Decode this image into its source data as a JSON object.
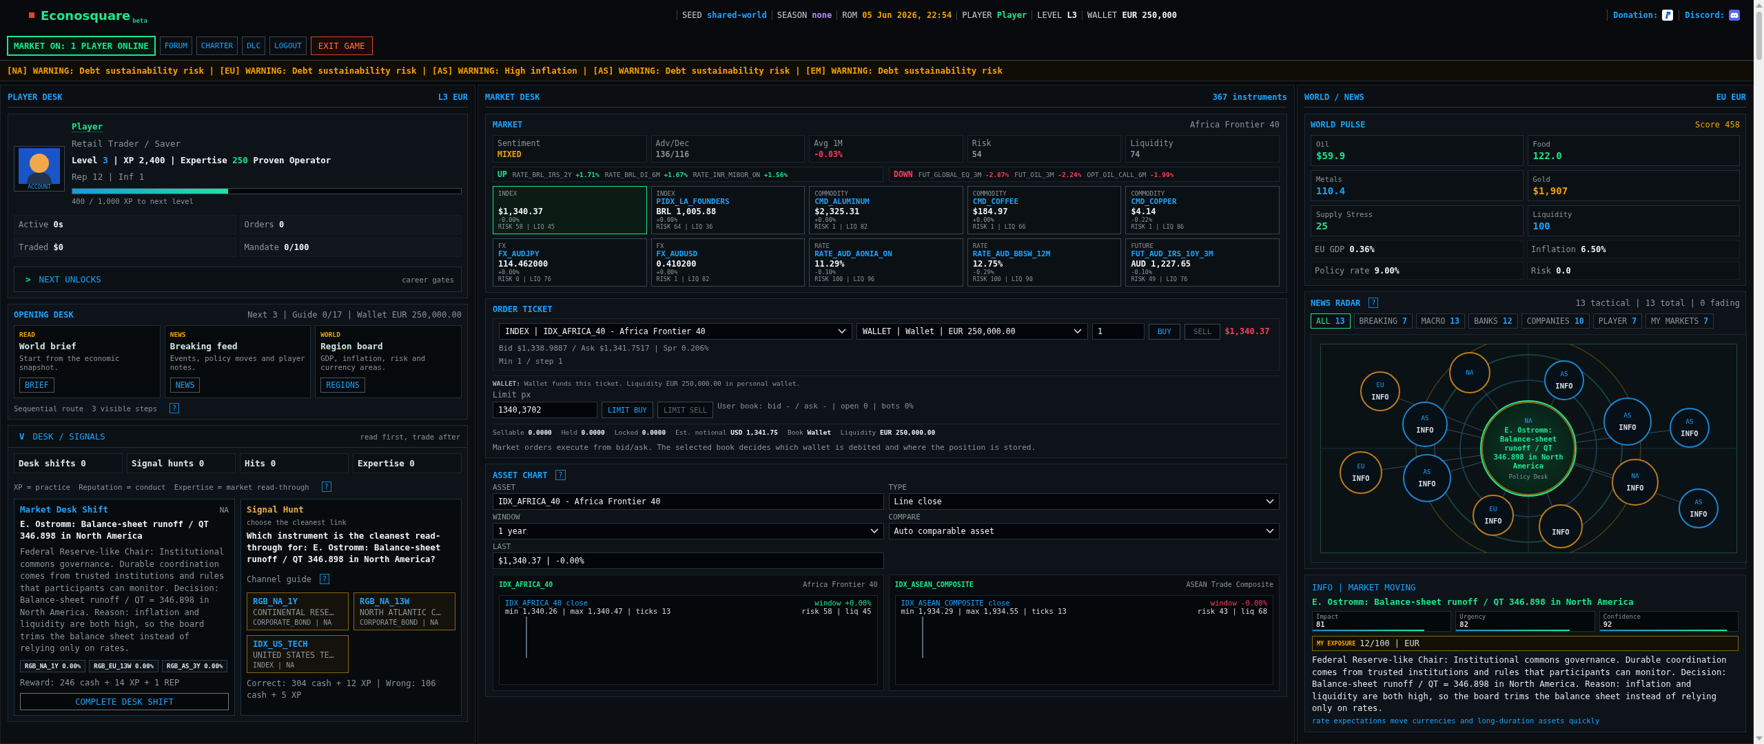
{
  "header": {
    "logo": "Econosquare",
    "logo_badge": "beta",
    "status": [
      {
        "label": "SEED",
        "value": "shared-world",
        "color": "#1aa3ff"
      },
      {
        "label": "SEASON",
        "value": "none",
        "color": "#b58cff"
      },
      {
        "label": "ROM",
        "value": "05 Jun 2026, 22:54",
        "color": "#f5a000"
      },
      {
        "label": "PLAYER",
        "value": "Player",
        "color": "#19e68c"
      },
      {
        "label": "LEVEL",
        "value": "L3",
        "color": "#eef2f5"
      },
      {
        "label": "WALLET",
        "value": "EUR 250,000",
        "color": "#eef2f5"
      }
    ],
    "links": [
      {
        "label": "Donation:"
      },
      {
        "label": "Discord:"
      }
    ],
    "market_status": "MARKET ON: 1 PLAYER ONLINE",
    "nav": [
      {
        "label": "FORUM",
        "kind": "nav"
      },
      {
        "label": "CHARTER",
        "kind": "nav"
      },
      {
        "label": "DLC",
        "kind": "nav"
      },
      {
        "label": "LOGOUT",
        "kind": "nav"
      },
      {
        "label": "EXIT GAME",
        "kind": "danger"
      }
    ]
  },
  "ticker": "[NA] WARNING: Debt sustainability risk | [EU] WARNING: Debt sustainability risk | [AS] WARNING: High inflation | [AS] WARNING: Debt sustainability risk | [EM] WARNING: Debt sustainability risk",
  "player_desk": {
    "title": "PLAYER DESK",
    "meta": "L3 EUR",
    "profile": {
      "name": "Player",
      "avatar_label": "ACCOUNT",
      "role": "Retail Trader / Saver",
      "stats_line": [
        {
          "text": "Level ",
          "color": "#eef2f5"
        },
        {
          "text": "3",
          "color": "#1aa3ff"
        },
        {
          "text": " | XP 2,400 | Expertise ",
          "color": "#eef2f5"
        },
        {
          "text": "250",
          "color": "#19e68c"
        },
        {
          "text": " Proven Operator",
          "color": "#eef2f5"
        }
      ],
      "rep": "Rep 12 | Inf 1",
      "level": 0.4,
      "xp_caption": "400 / 1,000 XP to next level"
    },
    "stats": [
      {
        "label": "Active",
        "value": "0s"
      },
      {
        "label": "Orders",
        "value": "0"
      },
      {
        "label": "Traded",
        "value": "$0"
      },
      {
        "label": "Mandate",
        "value": "0/100"
      }
    ],
    "unlocks": {
      "caret": ">",
      "label": "NEXT UNLOCKS",
      "meta": "career gates"
    }
  },
  "opening_desk": {
    "title": "OPENING DESK",
    "meta": "Next 3 | Guide 0/17 | Wallet EUR 250,000.00",
    "cards": [
      {
        "tag": "READ",
        "title": "World brief",
        "desc": "Start from the economic snapshot.",
        "button": "BRIEF"
      },
      {
        "tag": "NEWS",
        "title": "Breaking feed",
        "desc": "Events, policy moves and player notes.",
        "button": "NEWS"
      },
      {
        "tag": "WORLD",
        "title": "Region board",
        "desc": "GDP, inflation, risk and currency areas.",
        "button": "REGIONS"
      }
    ],
    "route": "Sequential route",
    "steps": "3 visible steps",
    "help": "?"
  },
  "signals": {
    "caret": "V",
    "title": "DESK / SIGNALS",
    "meta": "read first, trade after",
    "counters": [
      {
        "label": "Desk shifts",
        "value": "0"
      },
      {
        "label": "Signal hunts",
        "value": "0"
      },
      {
        "label": "Hits",
        "value": "0"
      },
      {
        "label": "Expertise",
        "value": "0"
      }
    ],
    "legend": [
      "XP = practice",
      "Reputation = conduct",
      "Expertise = market read-through"
    ],
    "help": "?",
    "shift": {
      "title": "Market Desk Shift",
      "region": "NA",
      "headline": "E. Ostromm: Balance-sheet runoff / QT 346.898 in North America",
      "body": "Federal Reserve-like Chair: Institutional commons governance. Durable coordination comes from trusted institutions and rules that participants can monitor. Decision: Balance-sheet runoff / QT = 346.898 in North America. Reason: inflation and liquidity are both high, so the board trims the balance sheet instead of relying only on rates.",
      "chips": [
        "RGB_NA_1Y 0.00%",
        "RGB_EU_13W 0.00%",
        "RGB_AS_3Y 0.00%"
      ],
      "reward": "Reward: 246 cash + 14 XP + 1 REP",
      "button": "COMPLETE DESK SHIFT"
    },
    "hunt": {
      "title": "Signal Hunt",
      "subtitle": "choose the cleanest link",
      "question": "Which instrument is the cleanest read-through for: E. Ostromm: Balance-sheet runoff / QT 346.898 in North America?",
      "guide": "Channel guide",
      "help": "?",
      "options": [
        {
          "symbol": "RGB_NA_1Y",
          "name": "CONTINENTAL RESE…",
          "meta": "CORPORATE_BOND | NA"
        },
        {
          "symbol": "RGB_NA_13W",
          "name": "NORTH ATLANTIC C…",
          "meta": "CORPORATE_BOND | NA"
        },
        {
          "symbol": "IDX_US_TECH",
          "name": "UNITED STATES TE…",
          "meta": "INDEX | NA"
        }
      ],
      "payout": "Correct: 304 cash + 12 XP | Wrong: 106 cash + 5 XP"
    }
  },
  "market_desk": {
    "title": "MARKET DESK",
    "meta": "367 instruments",
    "market": {
      "title": "MARKET",
      "meta": "Africa Frontier 40",
      "stats": [
        {
          "label": "Sentiment",
          "value": "MIXED",
          "color": "#f5a000"
        },
        {
          "label": "Adv/Dec",
          "value": "136/116",
          "color": "#8a949c"
        },
        {
          "label": "Avg 1M",
          "value": "-0.03%",
          "color": "#ff3b5c"
        },
        {
          "label": "Risk",
          "value": "54",
          "color": "#8a949c"
        },
        {
          "label": "Liquidity",
          "value": "74",
          "color": "#8a949c"
        }
      ],
      "movers": [
        {
          "label": "UP",
          "color": "#19e68c",
          "items": [
            {
              "symbol": "RATE_BRL_IRS_2Y",
              "change": "+1.71%"
            },
            {
              "symbol": "RATE_BRL_DI_6M",
              "change": "+1.67%"
            },
            {
              "symbol": "RATE_INR_MIBOR_ON",
              "change": "+1.56%"
            }
          ]
        },
        {
          "label": "DOWN",
          "color": "#ff3b5c",
          "items": [
            {
              "symbol": "FUT_GLOBAL_EQ_3M",
              "change": "-2.87%"
            },
            {
              "symbol": "FUT_OIL_3M",
              "change": "-2.24%"
            },
            {
              "symbol": "OPT_OIL_CALL_6M",
              "change": "-1.99%"
            }
          ]
        }
      ],
      "instruments": [
        {
          "type": "INDEX",
          "price": "$1,340.37",
          "change": "-0.00%",
          "meta": "RISK 58 | LIQ 45",
          "selected": true
        },
        {
          "type": "INDEX",
          "symbol": "PIDX_LA_FOUNDERS",
          "price": "BRL 1,005.88",
          "change": "+0.00%",
          "meta": "RISK 64 | LIQ 36",
          "selected": false
        },
        {
          "type": "COMMODITY",
          "symbol": "CMD_ALUMINUM",
          "price": "$2,325.31",
          "change": "+0.00%",
          "meta": "RISK 1 | LIQ 82",
          "selected": false
        },
        {
          "type": "COMMODITY",
          "symbol": "CMD_COFFEE",
          "price": "$184.97",
          "change": "+0.00%",
          "meta": "RISK 1 | LIQ 66",
          "selected": false
        },
        {
          "type": "COMMODITY",
          "symbol": "CMD_COPPER",
          "price": "$4.14",
          "change": "-0.22%",
          "meta": "RISK 1 | LIQ 86",
          "selected": false
        },
        {
          "type": "FX",
          "symbol": "FX_AUDJPY",
          "price": "114.462000",
          "change": "+0.00%",
          "meta": "RISK 0 | LIQ 76",
          "selected": false
        },
        {
          "type": "FX",
          "symbol": "FX_AUDUSD",
          "price": "0.410200",
          "change": "+0.00%",
          "meta": "RISK 1 | LIQ 82",
          "selected": false
        },
        {
          "type": "RATE",
          "symbol": "RATE_AUD_AONIA_ON",
          "price": "11.29%",
          "change": "-0.10%",
          "meta": "RISK 100 | LIQ 96",
          "selected": false
        },
        {
          "type": "RATE",
          "symbol": "RATE_AUD_BBSW_12M",
          "price": "12.75%",
          "change": "-0.29%",
          "meta": "RISK 100 | LIQ 90",
          "selected": false
        },
        {
          "type": "FUTURE",
          "symbol": "FUT_AUD_IRS_10Y_3M",
          "price": "AUD 1,227.65",
          "change": "-0.10%",
          "meta": "RISK 49 | LIQ 76",
          "selected": false
        }
      ]
    },
    "order_ticket": {
      "title": "ORDER TICKET",
      "instrument": "INDEX | IDX_AFRICA_40 - Africa Frontier 40",
      "wallet": "WALLET | Wallet | EUR 250,000.00",
      "quantity": "1",
      "buttons": [
        {
          "label": "BUY",
          "disabled": false
        },
        {
          "label": "SELL",
          "disabled": true
        }
      ],
      "total": "$1,340.37",
      "quote": "Bid $1,338.9887 / Ask $1,341.7517 | Spr 0.206%",
      "min_step": "Min 1 / step 1",
      "wallet_note": "**WALLET:** Wallet funds this ticket. Liquidity EUR 250,000.00 in personal wallet.",
      "limit_label": "Limit px",
      "limit_value": "1340,3702",
      "limit_buttons": [
        {
          "label": "LIMIT BUY",
          "disabled": false
        },
        {
          "label": "LIMIT SELL",
          "disabled": true
        }
      ],
      "user_book": "User book: bid - / ask - | open 0 | bots 0%",
      "balances": [
        {
          "label": "Sellable",
          "value": "0.0000"
        },
        {
          "label": "Held",
          "value": "0.0000"
        },
        {
          "label": "Locked",
          "value": "0.0000"
        },
        {
          "label": "Est. notional",
          "value": "USD 1,341.75"
        },
        {
          "label": "Book",
          "value": "Wallet"
        },
        {
          "label": "Liquidity",
          "value": "EUR 250,000.00"
        }
      ],
      "note": "Market orders execute from bid/ask. The selected book decides which wallet is debited and where the position is stored."
    },
    "asset_chart": {
      "title": "ASSET CHART",
      "help": "?",
      "fields": [
        {
          "label": "ASSET",
          "value": "IDX_AFRICA_40 - Africa Frontier 40",
          "kind": "input"
        },
        {
          "label": "TYPE",
          "value": "Line close",
          "kind": "select"
        },
        {
          "label": "WINDOW",
          "value": "1 year",
          "kind": "select"
        },
        {
          "label": "COMPARE",
          "value": "Auto comparable asset",
          "kind": "select"
        },
        {
          "label": "LAST",
          "value": "$1,340.37 | -0.00%",
          "kind": "input"
        }
      ],
      "panels": [
        {
          "symbol": "IDX_AFRICA_40",
          "name": "Africa Frontier 40",
          "series": "IDX_AFRICA_40 close",
          "range": "min 1,340.26 | max 1,340.47 | ticks 13",
          "window": "window +0.00%",
          "color": "#19e68c",
          "risk": "risk 58 | liq 45"
        },
        {
          "symbol": "IDX_ASEAN_COMPOSITE",
          "name": "ASEAN Trade Composite",
          "series": "IDX_ASEAN_COMPOSITE close",
          "range": "min 1,934.29 | max 1,934.55 | ticks 13",
          "window": "window -0.00%",
          "color": "#ff3b5c",
          "risk": "risk 43 | liq 68"
        }
      ]
    }
  },
  "world": {
    "title": "WORLD / NEWS",
    "meta": "EU EUR",
    "pulse": {
      "title": "WORLD PULSE",
      "score": "Score 458",
      "tiles": [
        {
          "label": "Oil",
          "value": "$59.9",
          "color": "#19e68c"
        },
        {
          "label": "Food",
          "value": "122.0",
          "color": "#19e68c"
        },
        {
          "label": "Metals",
          "value": "110.4",
          "color": "#1aa3ff"
        },
        {
          "label": "Gold",
          "value": "$1,907",
          "color": "#f5a000"
        },
        {
          "label": "Supply Stress",
          "value": "25",
          "color": "#19e68c"
        },
        {
          "label": "Liquidity",
          "value": "100",
          "color": "#1aa3ff"
        }
      ],
      "facts": [
        {
          "label": "EU GDP",
          "value": "0.36%"
        },
        {
          "label": "Inflation",
          "value": "6.50%"
        },
        {
          "label": "Policy rate",
          "value": "9.00%"
        },
        {
          "label": "Risk",
          "value": "0.0"
        }
      ]
    },
    "radar": {
      "title": "NEWS RADAR",
      "help": "?",
      "meta": "13 tactical | 13 total | 0 fading",
      "filters": [
        {
          "label": "ALL",
          "count": "13",
          "selected": true
        },
        {
          "label": "BREAKING",
          "count": "7",
          "selected": false
        },
        {
          "label": "MACRO",
          "count": "13",
          "selected": false
        },
        {
          "label": "BANKS",
          "count": "12",
          "selected": false
        },
        {
          "label": "COMPANIES",
          "count": "10",
          "selected": false
        },
        {
          "label": "PLAYER",
          "count": "7",
          "selected": false
        },
        {
          "label": "MY MARKETS",
          "count": "7",
          "selected": false
        }
      ],
      "nodes": [
        {
          "region": "AS",
          "label": "INFO",
          "color": "#1a86d0"
        },
        {
          "region": "EU",
          "label": "INFO",
          "color": "#c07a1a"
        },
        {
          "region": "NA",
          "color": "#c07a1a"
        },
        {
          "region": "AS",
          "label": "INFO",
          "color": "#1a86d0"
        },
        {
          "label": "INFO",
          "color": "#c07a1a"
        },
        {
          "region": "EU",
          "label": "INFO",
          "color": "#c07a1a"
        },
        {
          "region": "AS",
          "label": "INFO",
          "color": "#1a86d0"
        },
        {
          "region": "AS",
          "label": "INFO",
          "color": "#1a86d0"
        },
        {
          "region": "EU",
          "label": "INFO",
          "color": "#c07a1a"
        },
        {
          "region": "AS",
          "label": "INFO",
          "color": "#1a86d0"
        },
        {
          "region": "NA",
          "label": "INFO",
          "color": "#c07a1a"
        },
        {
          "region": "AS",
          "label": "INFO",
          "color": "#1a86d0"
        }
      ],
      "focus": {
        "region": "NA",
        "title": "E. Ostromm: Balance-sheet runoff / QT 346.898 in North America",
        "desk": "Policy Desk"
      }
    },
    "story": {
      "tag": "INFO | MARKET MOVING",
      "headline": "E. Ostromm: Balance-sheet runoff / QT 346.898 in North America",
      "gauges": [
        {
          "label": "Impact",
          "value": "81",
          "level": 0.81
        },
        {
          "label": "Urgency",
          "value": "82",
          "level": 0.82
        },
        {
          "label": "Confidence",
          "value": "92",
          "level": 0.92
        }
      ],
      "exposure_label": "MY EXPOSURE",
      "exposure": "12/100 | EUR",
      "body": "Federal Reserve-like Chair: Institutional commons governance. Durable coordination comes from trusted institutions and rules that participants can monitor. Decision: Balance-sheet runoff / QT = 346.898 in North America. Reason: inflation and liquidity are both high, so the board trims the balance sheet instead of relying only on rates.",
      "footnote": "rate expectations move currencies and long-duration assets quickly"
    }
  }
}
